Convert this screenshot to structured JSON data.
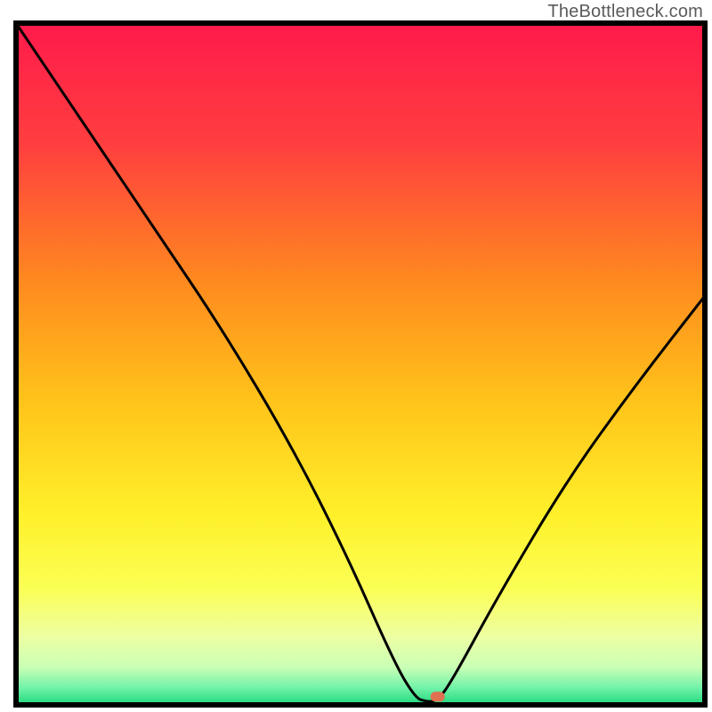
{
  "attribution": "TheBottleneck.com",
  "chart_data": {
    "type": "line",
    "title": "",
    "xlabel": "",
    "ylabel": "",
    "xlim": [
      0,
      100
    ],
    "ylim": [
      0,
      100
    ],
    "grid": false,
    "series": [
      {
        "name": "bottleneck-curve",
        "x": [
          0,
          12,
          20,
          30,
          40,
          48,
          55,
          58,
          59.5,
          61,
          63,
          70,
          80,
          90,
          100
        ],
        "values": [
          100,
          82,
          70,
          55,
          38,
          22,
          6,
          1,
          0.5,
          0.5,
          3,
          16,
          33,
          47,
          60
        ]
      }
    ],
    "marker": {
      "x": 61.2,
      "y": 1.2
    },
    "gradient_stops": [
      {
        "offset": 0.0,
        "color": "#ff1a4b"
      },
      {
        "offset": 0.18,
        "color": "#ff3f3f"
      },
      {
        "offset": 0.38,
        "color": "#ff8a1f"
      },
      {
        "offset": 0.55,
        "color": "#ffc21a"
      },
      {
        "offset": 0.72,
        "color": "#fff02a"
      },
      {
        "offset": 0.83,
        "color": "#fbff55"
      },
      {
        "offset": 0.9,
        "color": "#edffa3"
      },
      {
        "offset": 0.945,
        "color": "#c9ffb5"
      },
      {
        "offset": 0.975,
        "color": "#71f2a9"
      },
      {
        "offset": 1.0,
        "color": "#1fd87d"
      }
    ],
    "marker_color": "#e0704f",
    "curve_color": "#000000",
    "frame_color": "#000000"
  }
}
